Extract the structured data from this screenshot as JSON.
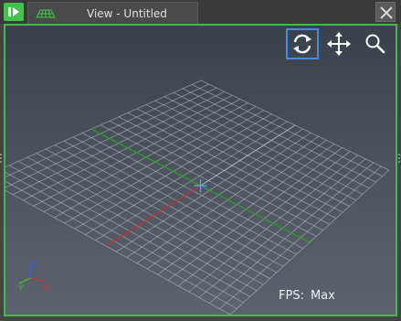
{
  "window": {
    "tab_title": "View - Untitled",
    "accent_color": "#45b84c",
    "dock_toggle_icon": "panel-toggle-icon",
    "tab_icon": "grid-plane-icon",
    "close_icon": "close-icon"
  },
  "viewport": {
    "nav_buttons": [
      {
        "name": "orbit",
        "icon": "orbit-icon",
        "active": true
      },
      {
        "name": "pan",
        "icon": "pan-icon",
        "active": false
      },
      {
        "name": "zoom",
        "icon": "zoom-icon",
        "active": false
      }
    ],
    "fps_label": "FPS:",
    "fps_value": "Max",
    "axis_gizmo": {
      "x_label": "X",
      "y_label": "Y",
      "z_label": "Z",
      "x_color": "#e03030",
      "y_color": "#2ec42e",
      "z_color": "#3060ff"
    },
    "grid_color": "#c9ccd2",
    "x_axis_color": "#c03232",
    "z_axis_color": "#2a9a2a",
    "origin_color": "#5aa0ff"
  }
}
